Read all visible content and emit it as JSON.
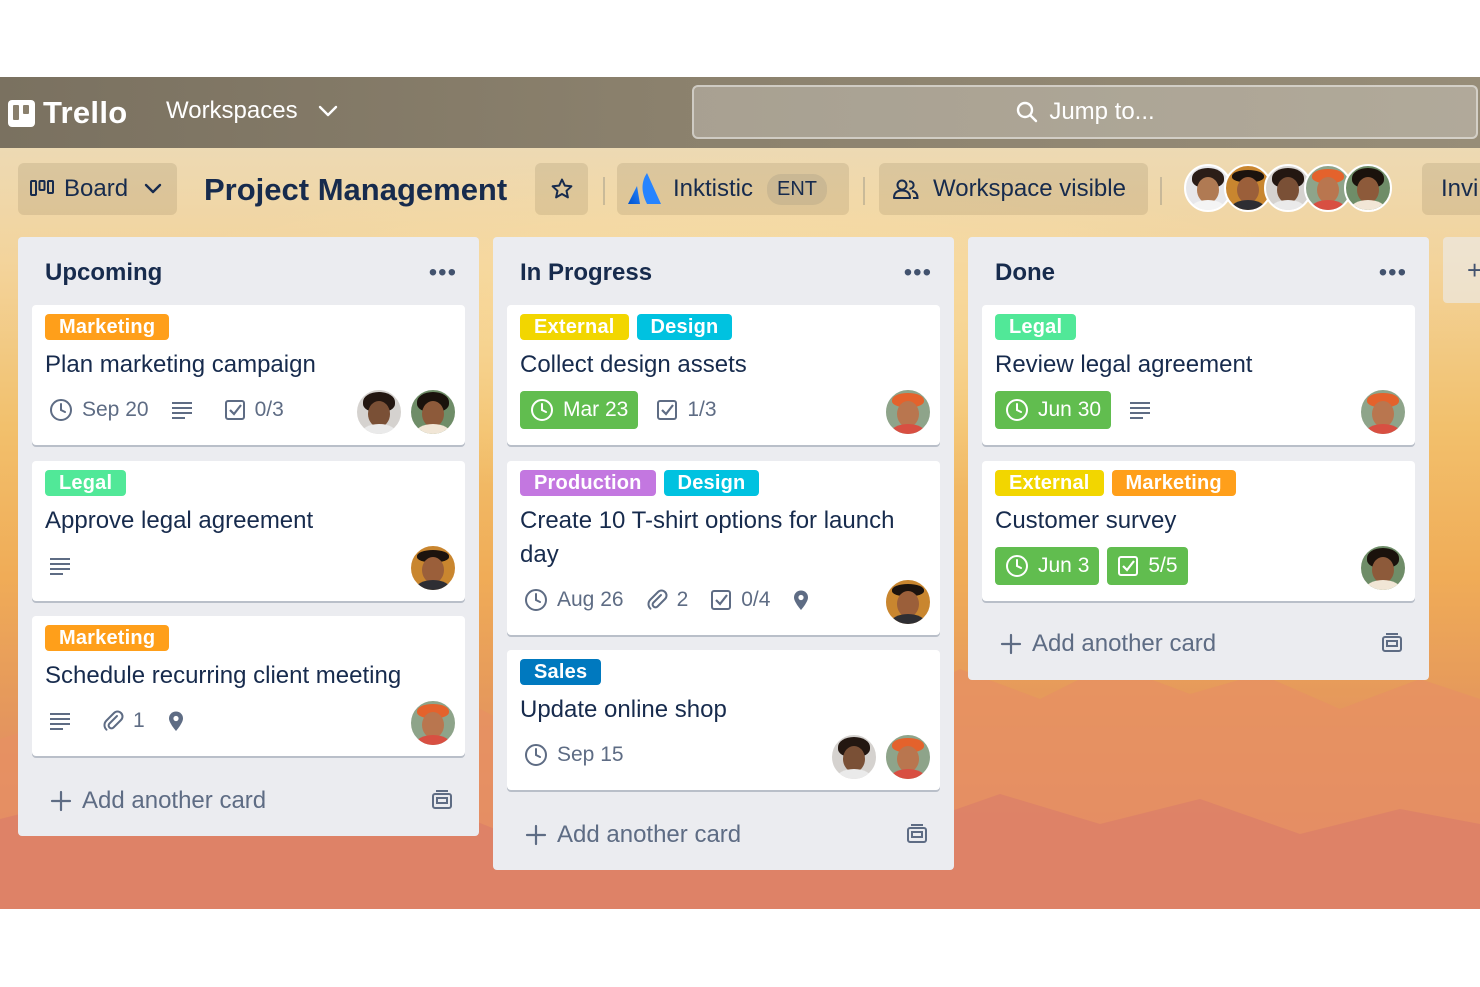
{
  "nav": {
    "logo": "Trello",
    "workspaces": "Workspaces",
    "search_placeholder": "Jump to..."
  },
  "board": {
    "view_label": "Board",
    "title": "Project Management",
    "workspace_name": "Inktistic",
    "workspace_badge": "ENT",
    "visibility": "Workspace visible",
    "invite": "Invi"
  },
  "colors": {
    "orange": "#ff9f1a",
    "green_label": "#51e898",
    "yellow": "#f2d600",
    "cyan": "#00c2e0",
    "purple": "#c377e0",
    "blue": "#0079bf",
    "due_complete": "#61bd4f"
  },
  "lists": [
    {
      "title": "Upcoming",
      "add_card": "Add another card",
      "cards": [
        {
          "labels": [
            "Marketing"
          ],
          "title": "Plan marketing campaign",
          "due": "Sep 20",
          "checklist": "0/3"
        },
        {
          "labels": [
            "Legal"
          ],
          "title": "Approve legal agreement"
        },
        {
          "labels": [
            "Marketing"
          ],
          "title": "Schedule recurring client meeting",
          "attachments": "1"
        }
      ]
    },
    {
      "title": "In Progress",
      "add_card": "Add another card",
      "cards": [
        {
          "labels": [
            "External",
            "Design"
          ],
          "title": "Collect design assets",
          "due": "Mar 23",
          "checklist": "1/3"
        },
        {
          "labels": [
            "Production",
            "Design"
          ],
          "title": "Create 10 T-shirt options for launch day",
          "due": "Aug 26",
          "attachments": "2",
          "checklist": "0/4"
        },
        {
          "labels": [
            "Sales"
          ],
          "title": "Update online shop",
          "due": "Sep 15"
        }
      ]
    },
    {
      "title": "Done",
      "add_card": "Add another card",
      "cards": [
        {
          "labels": [
            "Legal"
          ],
          "title": "Review legal agreement",
          "due": "Jun 30"
        },
        {
          "labels": [
            "External",
            "Marketing"
          ],
          "title": "Customer survey",
          "due": "Jun 3",
          "checklist": "5/5"
        }
      ]
    }
  ],
  "icons": [
    "trello-logo-icon",
    "chevron-down-icon",
    "search-icon",
    "board-icon",
    "star-icon",
    "atlassian-icon",
    "people-icon",
    "clock-icon",
    "description-icon",
    "checklist-icon",
    "attachment-icon",
    "location-icon",
    "plus-icon",
    "template-icon",
    "more-icon"
  ]
}
